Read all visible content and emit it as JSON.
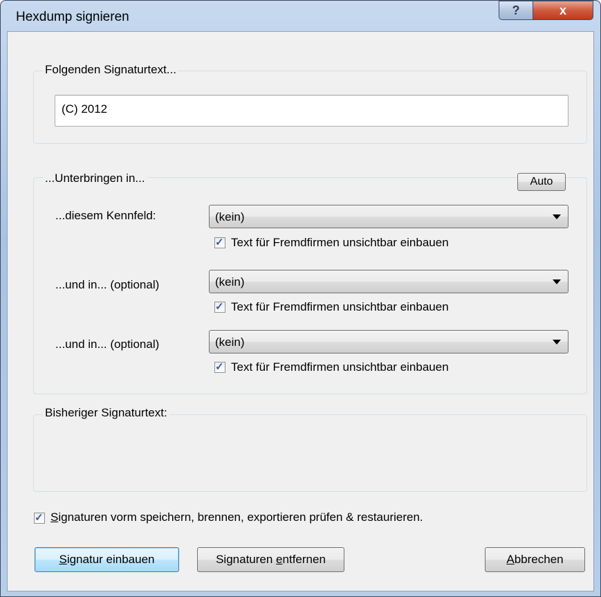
{
  "window": {
    "title": "Hexdump signieren",
    "help_label": "?",
    "close_label": "x"
  },
  "signature_group": {
    "label": "Folgenden Signaturtext...",
    "input_value": "(C) 2012"
  },
  "placement_group": {
    "label": "...Unterbringen in...",
    "auto_button": "Auto",
    "rows": [
      {
        "label": "...diesem Kennfeld:",
        "selected": "(kein)",
        "checkbox_label": "Text für Fremdfirmen unsichtbar einbauen",
        "checked": true
      },
      {
        "label": "...und in... (optional)",
        "selected": "(kein)",
        "checkbox_label": "Text für Fremdfirmen unsichtbar einbauen",
        "checked": true
      },
      {
        "label": "...und in... (optional)",
        "selected": "(kein)",
        "checkbox_label": "Text für Fremdfirmen unsichtbar einbauen",
        "checked": true
      }
    ]
  },
  "previous_group": {
    "label": "Bisheriger Signaturtext:",
    "value": ""
  },
  "verify_option": {
    "mnemonic": "S",
    "label_rest": "ignaturen vorm speichern, brennen, exportieren prüfen & restaurieren.",
    "checked": true
  },
  "buttons": {
    "embed": {
      "mnemonic": "S",
      "rest": "ignatur einbauen"
    },
    "remove": {
      "before": "Signaturen ",
      "mnemonic": "e",
      "rest": "ntfernen"
    },
    "cancel": {
      "mnemonic": "A",
      "rest": "bbrechen"
    }
  },
  "colors": {
    "accent_check": "#3a5ba0",
    "default_button_border": "#3c7fb1",
    "close_button": "#c0391c"
  }
}
